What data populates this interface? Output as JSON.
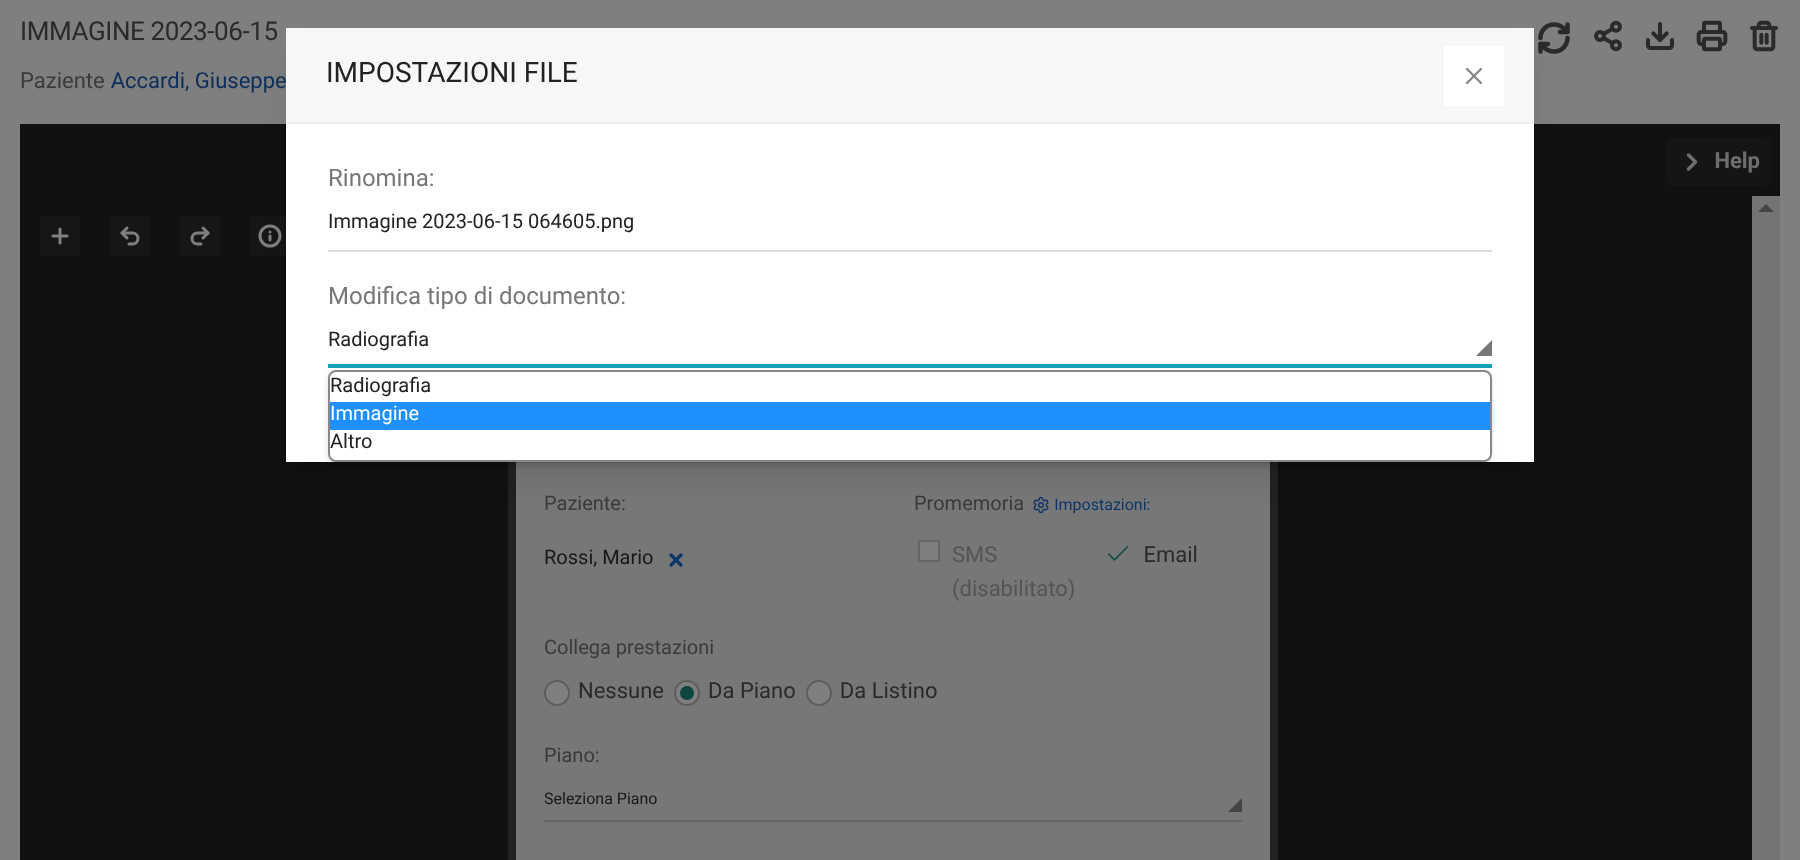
{
  "header": {
    "title": "IMMAGINE 2023-06-15",
    "patient_label": "Paziente",
    "patient_name": "Accardi, Giuseppe"
  },
  "viewer": {
    "help": "Help"
  },
  "document": {
    "patient_label": "Paziente:",
    "patient": "Rossi, Mario",
    "reminder_label": "Promemoria",
    "reminder_link": "Impostazioni:",
    "reminders": [
      {
        "label": "SMS",
        "note": "(disabilitato)",
        "checked": false,
        "disabled": true
      },
      {
        "label": "Email",
        "checked": true,
        "disabled": false
      }
    ],
    "link_label": "Collega prestazioni",
    "link_options": [
      {
        "label": "Nessune",
        "selected": false
      },
      {
        "label": "Da Piano",
        "selected": true
      },
      {
        "label": "Da Listino",
        "selected": false
      }
    ],
    "plan_label": "Piano:",
    "plan_select": "Seleziona Piano"
  },
  "dialog": {
    "title": "IMPOSTAZIONI FILE",
    "rename_label": "Rinomina:",
    "rename_value": "Immagine 2023-06-15 064605.png",
    "type_label": "Modifica tipo di documento:",
    "type_value": "Radiografia",
    "options": [
      {
        "label": "Radiografia",
        "selected": false
      },
      {
        "label": "Immagine",
        "selected": true
      },
      {
        "label": "Altro",
        "selected": false
      }
    ]
  }
}
